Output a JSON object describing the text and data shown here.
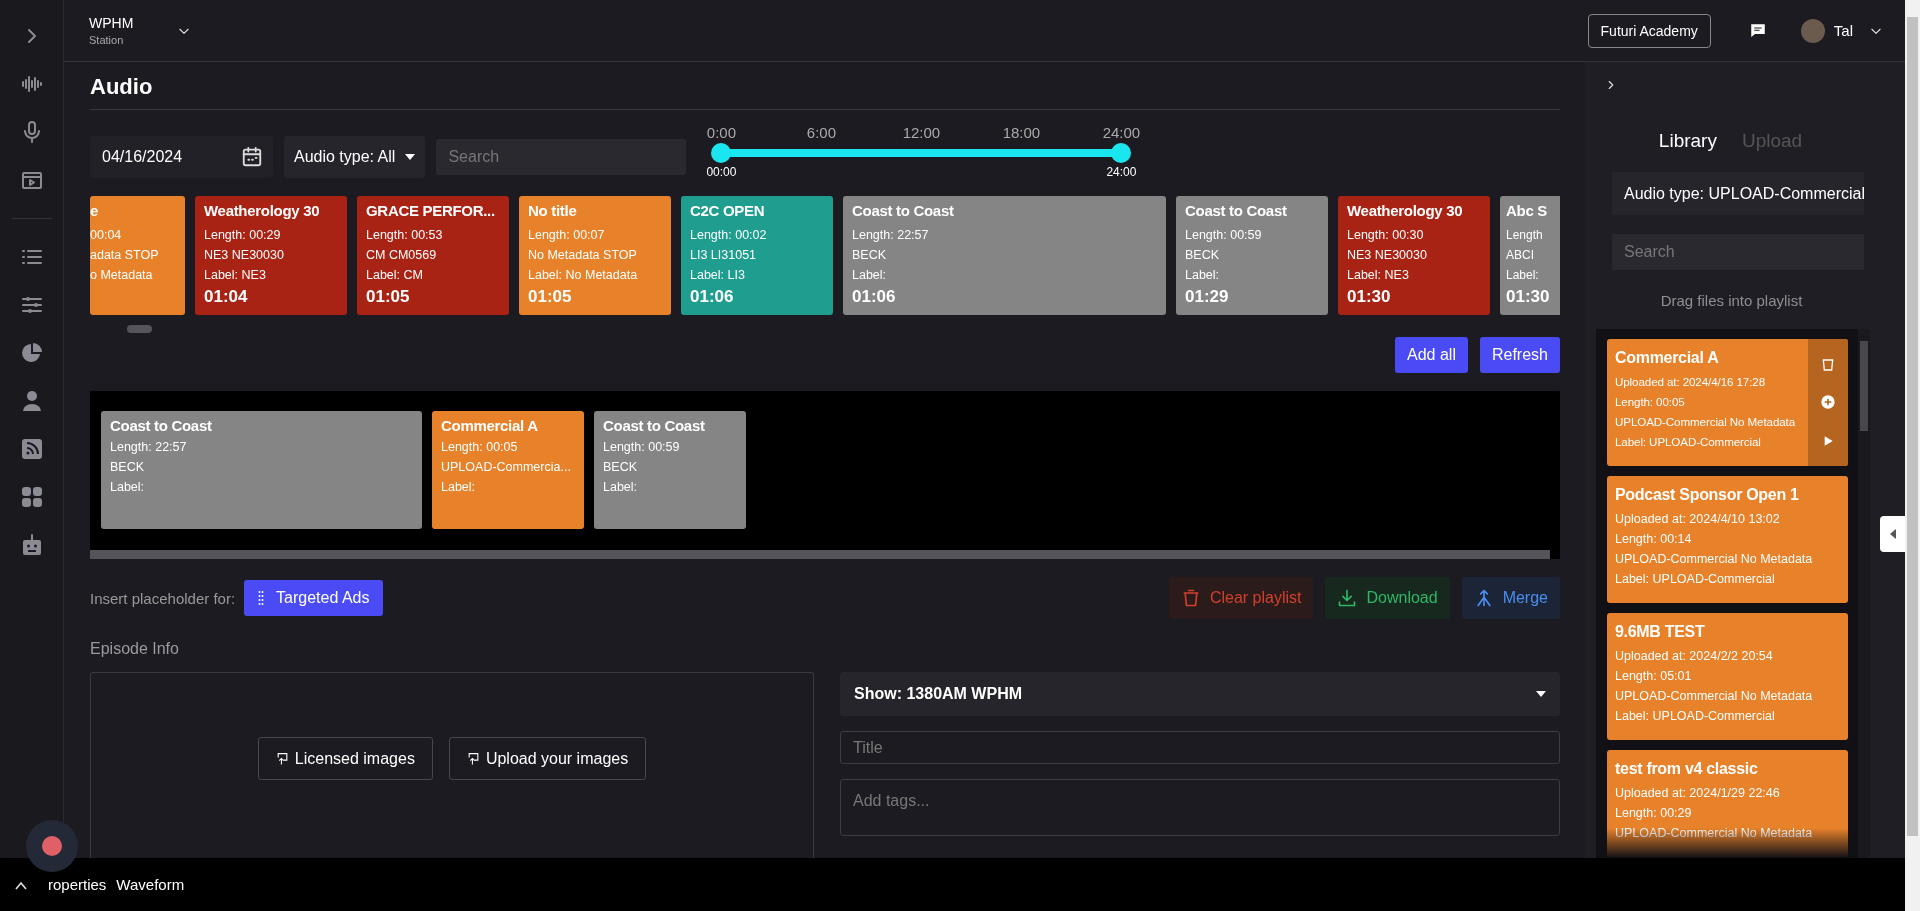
{
  "header": {
    "station": "WPHM",
    "station_sub": "Station",
    "academy_button": "Futuri Academy",
    "user": "Tal"
  },
  "page_title": "Audio",
  "filters": {
    "date": "04/16/2024",
    "audio_type": "Audio type: All",
    "search_placeholder": "Search"
  },
  "time_range": {
    "ticks": [
      "0:00",
      "6:00",
      "12:00",
      "18:00",
      "24:00"
    ],
    "start": {
      "level": 0,
      "reading": "00:00"
    },
    "end": {
      "level": 1,
      "reading": "24:00"
    }
  },
  "timeline_cards": [
    {
      "kind": "cut_start",
      "title": "e",
      "lines": [
        "00:04",
        "adata STOP",
        "o Metadata"
      ],
      "color": "#e8822a"
    },
    {
      "kind": "short",
      "title": "Weatherology 30",
      "lines": [
        "Length: 00:29",
        "NE3 NE30030",
        "Label: NE3"
      ],
      "time": "01:04",
      "color": "#a82314"
    },
    {
      "kind": "short",
      "title": "GRACE PERFOR...",
      "lines": [
        "Length: 00:53",
        "CM CM0569",
        "Label: CM"
      ],
      "time": "01:05",
      "color": "#a82314"
    },
    {
      "kind": "short",
      "title": "No title",
      "lines": [
        "Length: 00:07",
        "No Metadata STOP",
        "Label: No Metadata"
      ],
      "time": "01:05",
      "color": "#e8822a"
    },
    {
      "kind": "short",
      "title": "C2C OPEN",
      "lines": [
        "Length: 00:02",
        "LI3 LI31051",
        "Label: LI3"
      ],
      "time": "01:06",
      "color": "#1f9e8f"
    },
    {
      "kind": "long",
      "title": "Coast to Coast",
      "lines": [
        "Length: 22:57",
        "BECK",
        "Label:"
      ],
      "time": "01:06",
      "color": "#858585"
    },
    {
      "kind": "short",
      "title": "Coast to Coast",
      "lines": [
        "Length: 00:59",
        "BECK",
        "Label:"
      ],
      "time": "01:29",
      "color": "#858585"
    },
    {
      "kind": "short",
      "title": "Weatherology 30",
      "lines": [
        "Length: 00:30",
        "NE3 NE30030",
        "Label: NE3"
      ],
      "time": "01:30",
      "color": "#a82314"
    },
    {
      "kind": "cut_end",
      "title": "Abc S",
      "lines": [
        "Length",
        "ABCI",
        "Label:"
      ],
      "time": "01:30",
      "color": "#858585"
    }
  ],
  "list_buttons": [
    "Add all",
    "Refresh"
  ],
  "playlist": [
    {
      "kind": "long",
      "title": "Coast to Coast",
      "lines": [
        "Length: 22:57",
        "BECK",
        "Label:"
      ],
      "color": "#858585"
    },
    {
      "kind": "short",
      "title": "Commercial A",
      "lines": [
        "Length: 00:05",
        "UPLOAD-Commercia...",
        "Label:"
      ],
      "color": "#e8822a"
    },
    {
      "kind": "short",
      "title": "Coast to Coast",
      "lines": [
        "Length: 00:59",
        "BECK",
        "Label:"
      ],
      "color": "#858585"
    }
  ],
  "placeholder": {
    "label": "Insert placeholder for:",
    "button": "Targeted Ads"
  },
  "playlist_actions": [
    {
      "kind": "clear",
      "label": "Clear playlist"
    },
    {
      "kind": "download",
      "label": "Download"
    },
    {
      "kind": "merge",
      "label": "Merge"
    }
  ],
  "episode_info": {
    "heading": "Episode Info",
    "image_buttons": [
      "Licensed images",
      "Upload your images"
    ],
    "show": "Show: 1380AM WPHM",
    "title_placeholder": "Title",
    "tags_placeholder": "Add tags..."
  },
  "library": {
    "tabs": [
      {
        "label": "Library",
        "selected": true
      },
      {
        "label": "Upload",
        "selected": false
      }
    ],
    "audio_type": "Audio type: UPLOAD-Commercial",
    "search_placeholder": "Search",
    "hint": "Drag files into playlist",
    "items": [
      {
        "title": "Commercial A",
        "lines": [
          "Uploaded at: 2024/4/16 17:28",
          "Length: 00:05",
          "UPLOAD-Commercial No Metadata",
          "Label: UPLOAD-Commercial"
        ],
        "hovered": true
      },
      {
        "title": "Podcast Sponsor Open 1",
        "lines": [
          "Uploaded at: 2024/4/10 13:02",
          "Length: 00:14",
          "UPLOAD-Commercial No Metadata",
          "Label: UPLOAD-Commercial"
        ],
        "hovered": false
      },
      {
        "title": "9.6MB TEST",
        "lines": [
          "Uploaded at: 2024/2/2 20:54",
          "Length: 05:01",
          "UPLOAD-Commercial No Metadata",
          "Label: UPLOAD-Commercial"
        ],
        "hovered": false
      },
      {
        "title": "test from v4 classic",
        "lines": [
          "Uploaded at: 2024/1/29 22:46",
          "Length: 00:29",
          "UPLOAD-Commercial No Metadata"
        ],
        "hovered": false
      }
    ]
  },
  "bottom_tabs": [
    "roperties",
    "Waveform"
  ]
}
